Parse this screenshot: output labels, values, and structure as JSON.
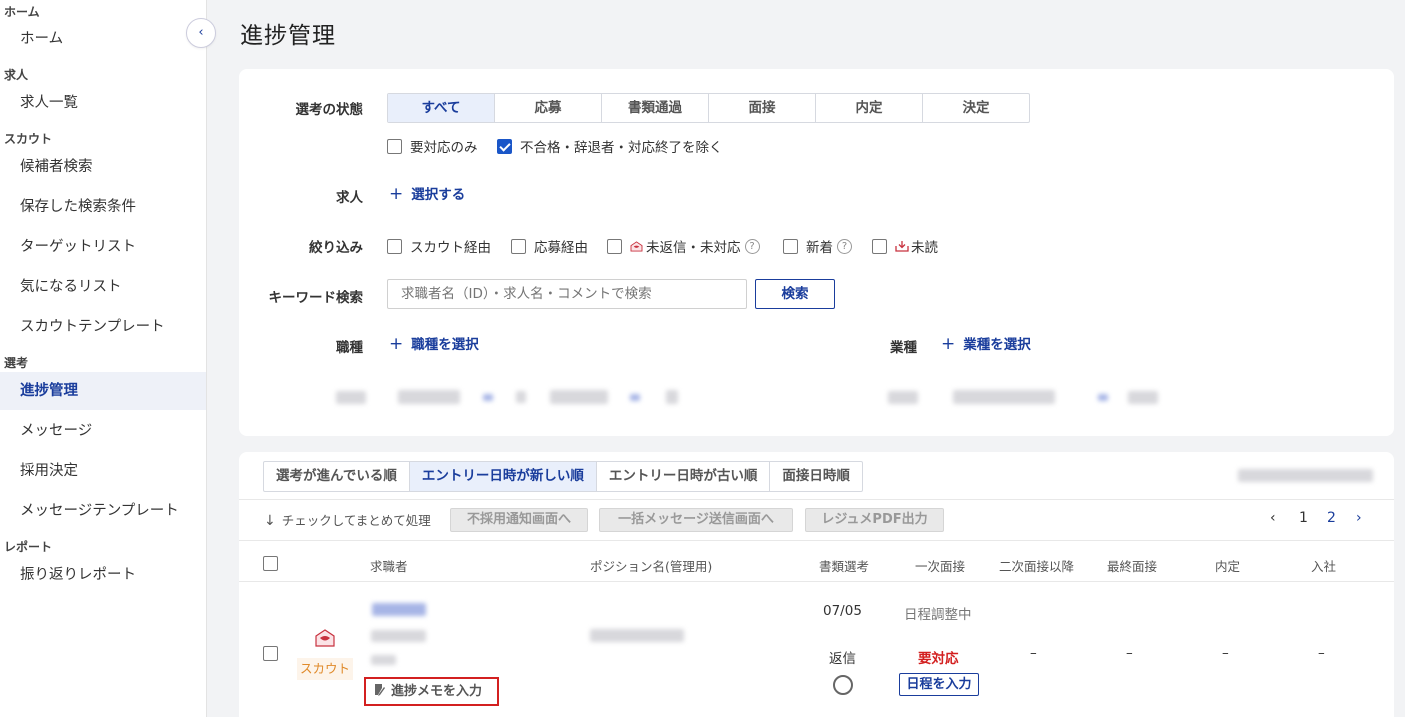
{
  "sidebar": {
    "sections": [
      {
        "title": "ホーム",
        "items": [
          "ホーム"
        ]
      },
      {
        "title": "求人",
        "items": [
          "求人一覧"
        ]
      },
      {
        "title": "スカウト",
        "items": [
          "候補者検索",
          "保存した検索条件",
          "ターゲットリスト",
          "気になるリスト",
          "スカウトテンプレート"
        ]
      },
      {
        "title": "選考",
        "items": [
          "進捗管理",
          "メッセージ",
          "採用決定",
          "メッセージテンプレート"
        ]
      },
      {
        "title": "レポート",
        "items": [
          "振り返りレポート"
        ]
      }
    ],
    "active_item": "進捗管理",
    "collapse_icon": "chevron-left-icon"
  },
  "page": {
    "title": "進捗管理"
  },
  "filters": {
    "status_label": "選考の状態",
    "status_tabs": [
      "すべて",
      "応募",
      "書類通過",
      "面接",
      "内定",
      "決定"
    ],
    "status_selected": "すべて",
    "needs_action_only": {
      "label": "要対応のみ",
      "checked": false
    },
    "exclude_rejected": {
      "label": "不合格・辞退者・対応終了を除く",
      "checked": true
    },
    "job_label": "求人",
    "job_select": "選択する",
    "narrow_label": "絞り込み",
    "narrow_options": [
      {
        "label": "スカウト経由",
        "checked": false
      },
      {
        "label": "応募経由",
        "checked": false
      },
      {
        "label": "未返信・未対応",
        "checked": false,
        "icon": "mail-icon",
        "help": "?"
      },
      {
        "label": "新着",
        "checked": false,
        "help": "?"
      },
      {
        "label": "未読",
        "checked": false,
        "icon": "inbox-icon"
      }
    ],
    "keyword_label": "キーワード検索",
    "keyword_placeholder": "求職者名（ID）・求人名・コメントで検索",
    "keyword_value": "",
    "search_button": "検索",
    "job_type_label": "職種",
    "job_type_select": "職種を選択",
    "industry_label": "業種",
    "industry_select": "業種を選択"
  },
  "results": {
    "sort_tabs": [
      "選考が進んでいる順",
      "エントリー日時が新しい順",
      "エントリー日時が古い順",
      "面接日時順"
    ],
    "sort_selected": "エントリー日時が新しい順",
    "bulk_label": "チェックしてまとめて処理",
    "bulk_buttons": [
      "不採用通知画面へ",
      "一括メッセージ送信画面へ",
      "レジュメPDF出力"
    ],
    "pagination": {
      "prev": "‹",
      "pages": [
        "1",
        "2"
      ],
      "current": "1",
      "next": "›"
    },
    "columns": [
      "求職者",
      "ポジション名(管理用)",
      "書類選考",
      "一次面接",
      "二次面接以降",
      "最終面接",
      "内定",
      "入社"
    ],
    "rows": [
      {
        "source_badge": "スカウト",
        "memo_button": "進捗メモを入力",
        "doc_screen_date": "07/05",
        "doc_screen_status": "返信",
        "first_interview_status": "日程調整中",
        "first_interview_action": "要対応",
        "schedule_button": "日程を入力",
        "second_interview": "–",
        "final_interview": "–",
        "offer": "–",
        "joined": "–"
      }
    ]
  },
  "colors": {
    "accent": "#1a3d9c",
    "alert": "#d32020",
    "scout": "#e08a2a"
  }
}
